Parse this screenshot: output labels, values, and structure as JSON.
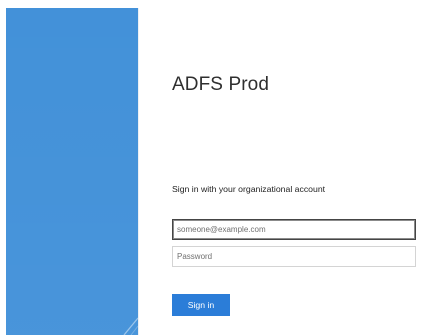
{
  "app": {
    "title": "ADFS Prod"
  },
  "form": {
    "instruction": "Sign in with your organizational account",
    "email_placeholder": "someone@example.com",
    "password_placeholder": "Password",
    "submit_label": "Sign in"
  },
  "theme": {
    "left_panel_color": "#3f8fd8",
    "button_color": "#2b7dd8",
    "input_border_focus": "#454545",
    "input_border": "#d4d4d4"
  }
}
